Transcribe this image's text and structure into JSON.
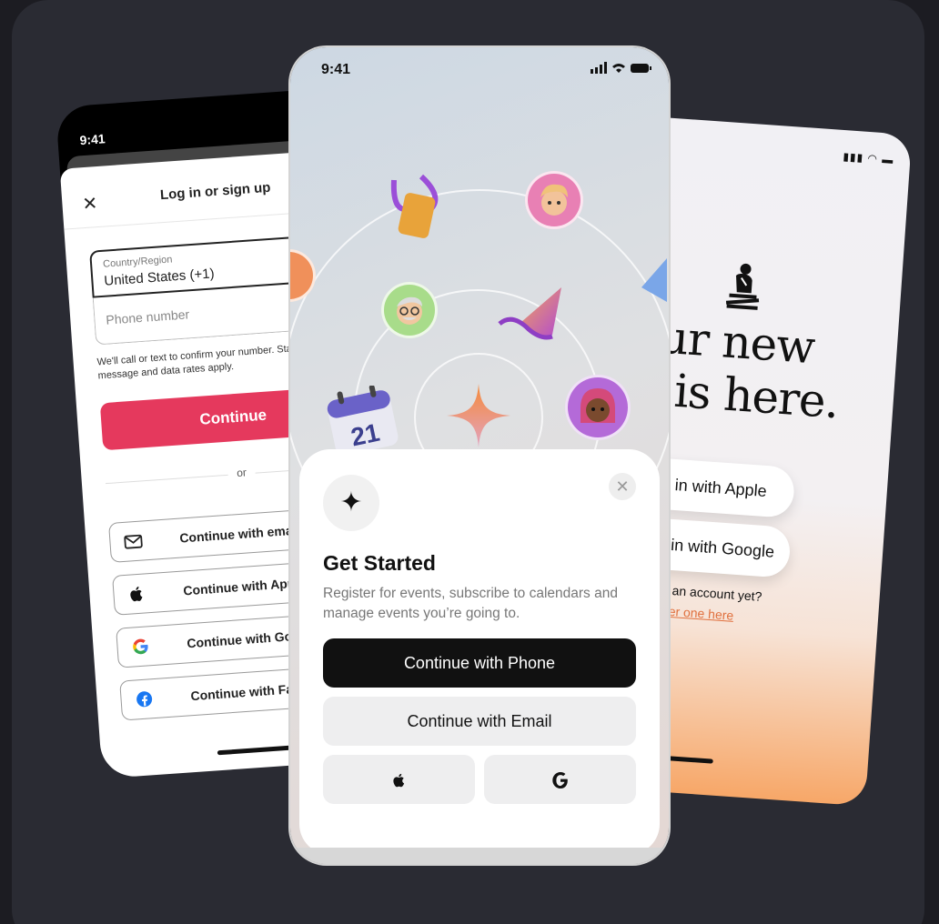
{
  "left_phone": {
    "time": "9:41",
    "title": "Log in or sign up",
    "country_label": "Country/Region",
    "country_value": "United States (+1)",
    "phone_placeholder": "Phone number",
    "note": "We'll call or text to confirm your number. Standard message and data rates apply.",
    "continue_label": "Continue",
    "or_label": "or",
    "buttons": [
      {
        "label": "Continue with email",
        "icon": "mail-icon"
      },
      {
        "label": "Continue with Apple",
        "icon": "apple-icon"
      },
      {
        "label": "Continue with Google",
        "icon": "google-icon"
      },
      {
        "label": "Continue with Facebook",
        "icon": "facebook-icon"
      }
    ]
  },
  "center_phone": {
    "time": "9:41",
    "sheet_title": "Get Started",
    "sheet_desc": "Register for events, subscribe to calendars and manage events you’re going to.",
    "phone_button": "Continue with Phone",
    "email_button": "Continue with Email",
    "calendar_day": "21"
  },
  "right_phone": {
    "headline_1": "Your new",
    "headline_2": "nd is here.",
    "apple_button": "Sign in with Apple",
    "google_button": "Sign in with Google",
    "account_text": "t have an account yet?",
    "register_link": "Register one here"
  },
  "colors": {
    "background": "#2a2b33",
    "primary_red": "#e5395d",
    "dark_button": "#111111",
    "link_orange": "#e0703e"
  }
}
